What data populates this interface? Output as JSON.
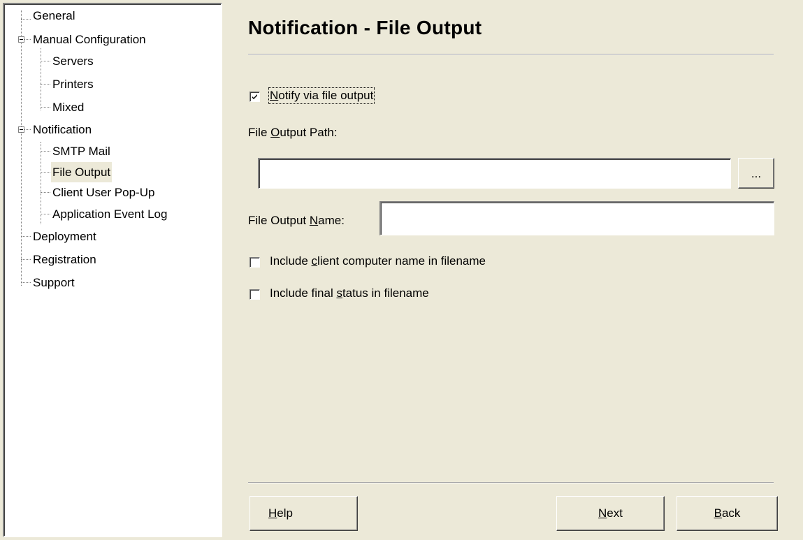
{
  "tree": {
    "items": [
      {
        "label": "General"
      },
      {
        "label": "Manual Configuration"
      },
      {
        "label": "Servers"
      },
      {
        "label": "Printers"
      },
      {
        "label": "Mixed"
      },
      {
        "label": "Notification"
      },
      {
        "label": "SMTP Mail"
      },
      {
        "label": "File Output",
        "selected": true
      },
      {
        "label": "Client User Pop-Up"
      },
      {
        "label": "Application Event Log"
      },
      {
        "label": "Deployment"
      },
      {
        "label": "Registration"
      },
      {
        "label": "Support"
      }
    ]
  },
  "page": {
    "title": "Notification - File Output"
  },
  "notify_checkbox": {
    "mnemonic": "N",
    "label_rest": "otify via file output",
    "checked": true
  },
  "output_path": {
    "label_pre": "File ",
    "mnemonic": "O",
    "label_rest": "utput Path:",
    "value": "",
    "browse_label": "..."
  },
  "output_name": {
    "label_pre": "File Output ",
    "mnemonic": "N",
    "label_rest": "ame:",
    "value": ""
  },
  "include_computer_name": {
    "label_pre": "Include ",
    "mnemonic": "c",
    "label_rest": "lient computer name in filename",
    "checked": false
  },
  "include_final_status": {
    "label_pre": "Include final ",
    "mnemonic": "s",
    "label_rest": "tatus in filename",
    "checked": false
  },
  "buttons": {
    "help": {
      "mnemonic": "H",
      "rest": "elp"
    },
    "next": {
      "mnemonic": "N",
      "rest": "ext"
    },
    "back": {
      "mnemonic": "B",
      "rest": "ack"
    }
  }
}
